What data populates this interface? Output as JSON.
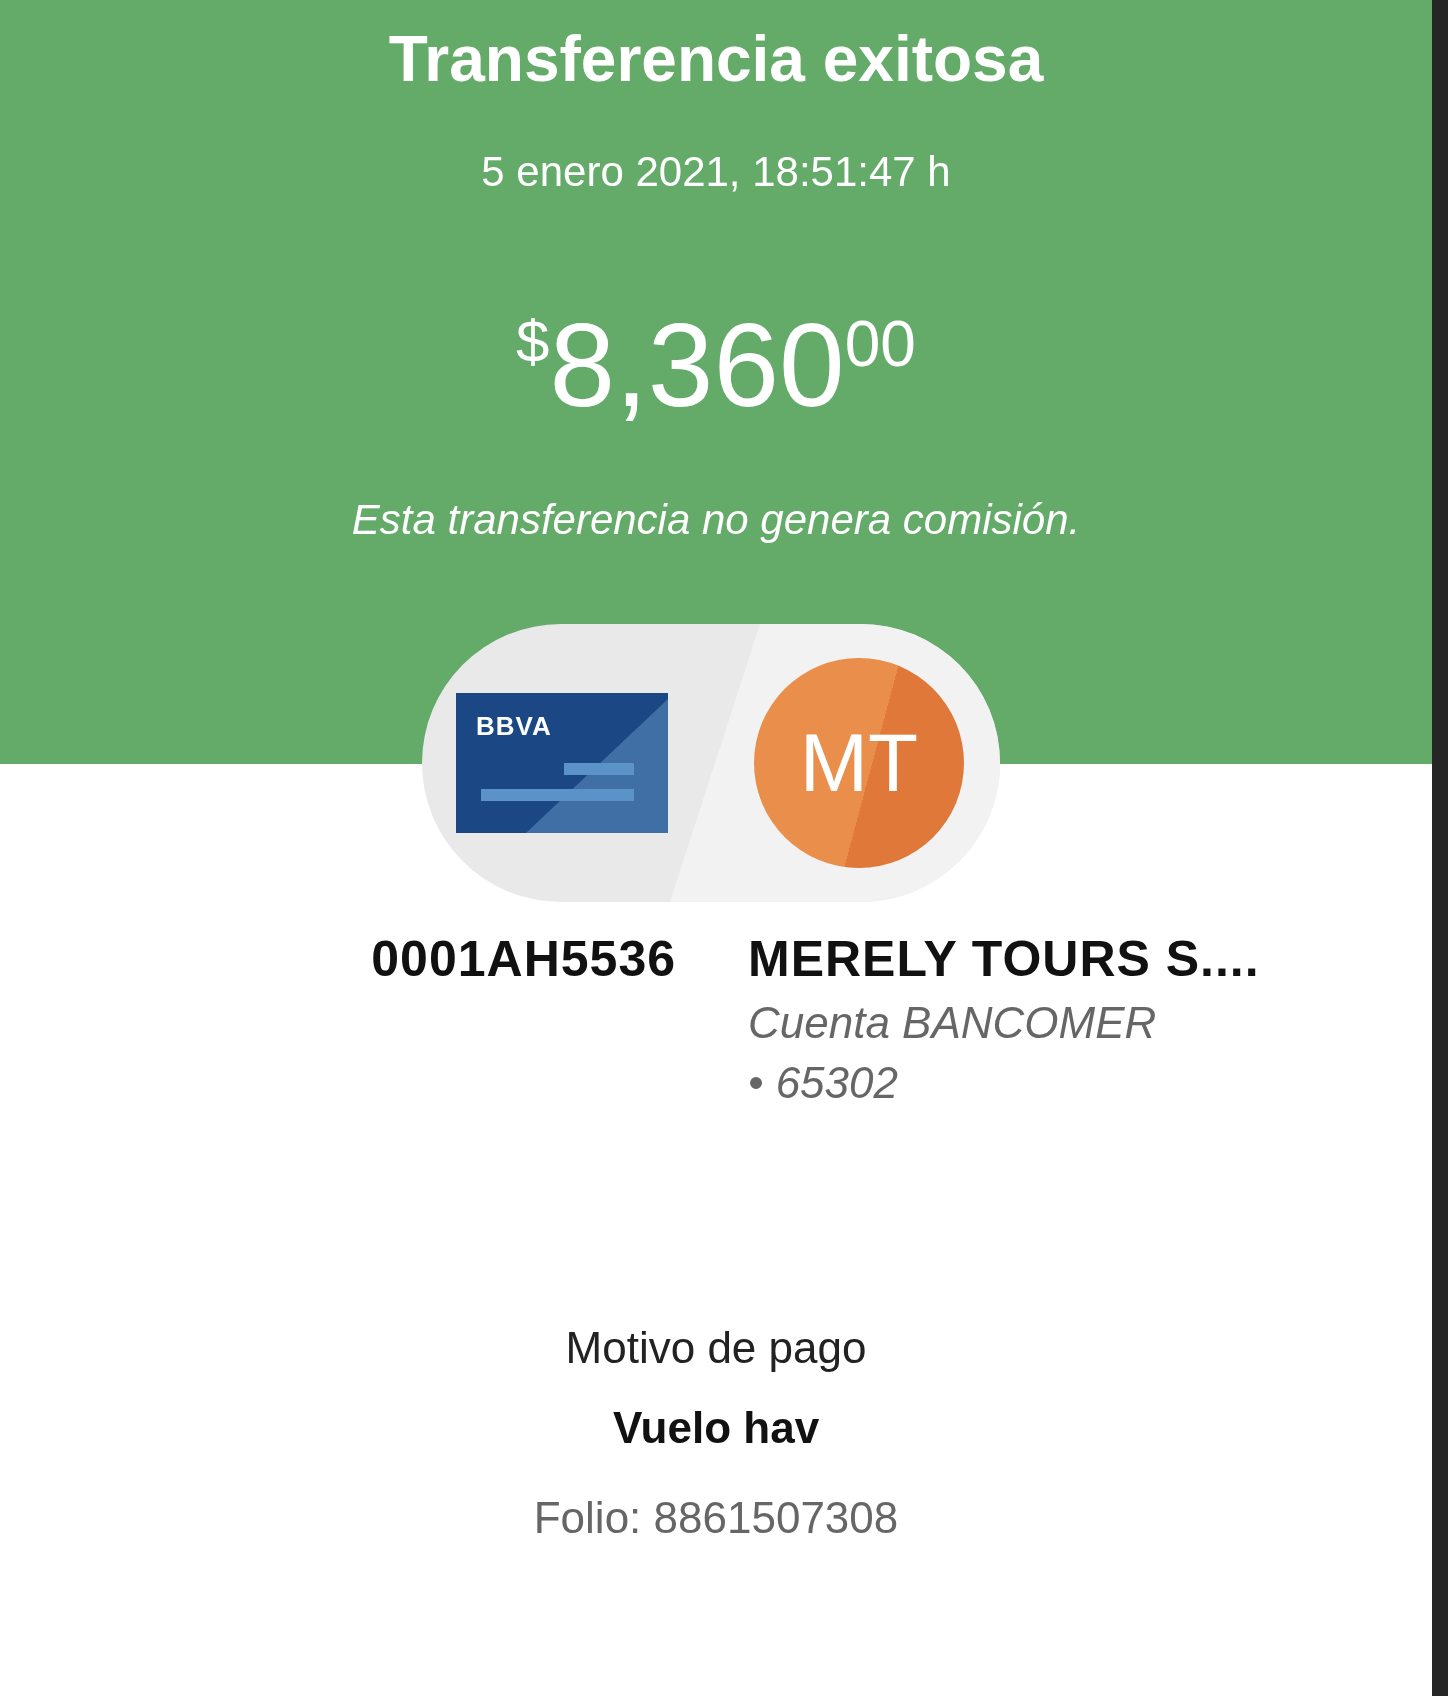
{
  "header": {
    "title": "Transferencia exitosa",
    "datetime": "5 enero 2021, 18:51:47 h",
    "amount": {
      "currency": "$",
      "whole": "8,360",
      "cents": "00"
    },
    "note": "Esta transferencia no genera comisión."
  },
  "origin": {
    "logo_text": "BBVA",
    "account": "0001AH5536"
  },
  "destination": {
    "initials": "MT",
    "name": "MERELY TOURS S....",
    "bank": "Cuenta BANCOMER",
    "number": "• 65302"
  },
  "details": {
    "label": "Motivo de pago",
    "value": "Vuelo hav",
    "folio": "Folio: 8861507308"
  }
}
